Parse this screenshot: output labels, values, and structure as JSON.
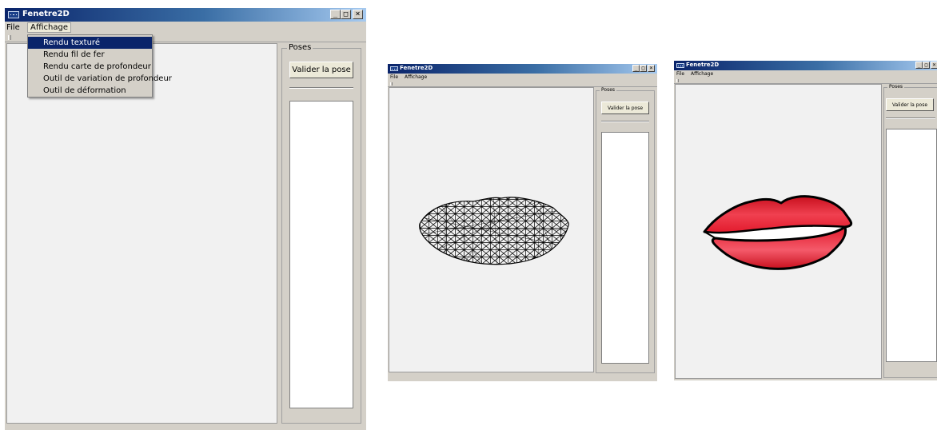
{
  "windows": [
    {
      "title": "Fenetre2D",
      "menu": [
        "File",
        "Affichage"
      ],
      "controls": [
        "_",
        "□",
        "×"
      ],
      "poses_label": "Poses",
      "validate_button": "Valider la pose",
      "toolbar_grip": "::"
    },
    {
      "title": "Fenetre2D",
      "menu": [
        "File",
        "Affichage"
      ],
      "controls": [
        "_",
        "□",
        "×"
      ],
      "poses_label": "Poses",
      "validate_button": "Valider la pose",
      "toolbar_grip": "::",
      "render_mode": "wireframe"
    },
    {
      "title": "Fenetre2D",
      "menu": [
        "File",
        "Affichage"
      ],
      "controls": [
        "_",
        "□",
        "×"
      ],
      "poses_label": "Poses",
      "validate_button": "Valider la pose",
      "toolbar_grip": "::",
      "render_mode": "textured"
    }
  ],
  "affichage_menu": {
    "items": [
      "Rendu texturé",
      "Rendu fil de fer",
      "Rendu carte de profondeur",
      "Outil de variation de profondeur",
      "Outil de déformation"
    ],
    "highlighted_index": 0
  },
  "colors": {
    "title_gradient_start": "#0a246a",
    "title_gradient_end": "#a6caf0",
    "window_face": "#d4d0c8",
    "canvas": "#f1f1f1",
    "menu_highlight": "#0a246a",
    "lips_red": "#e8202e",
    "lips_outline": "#000000"
  }
}
